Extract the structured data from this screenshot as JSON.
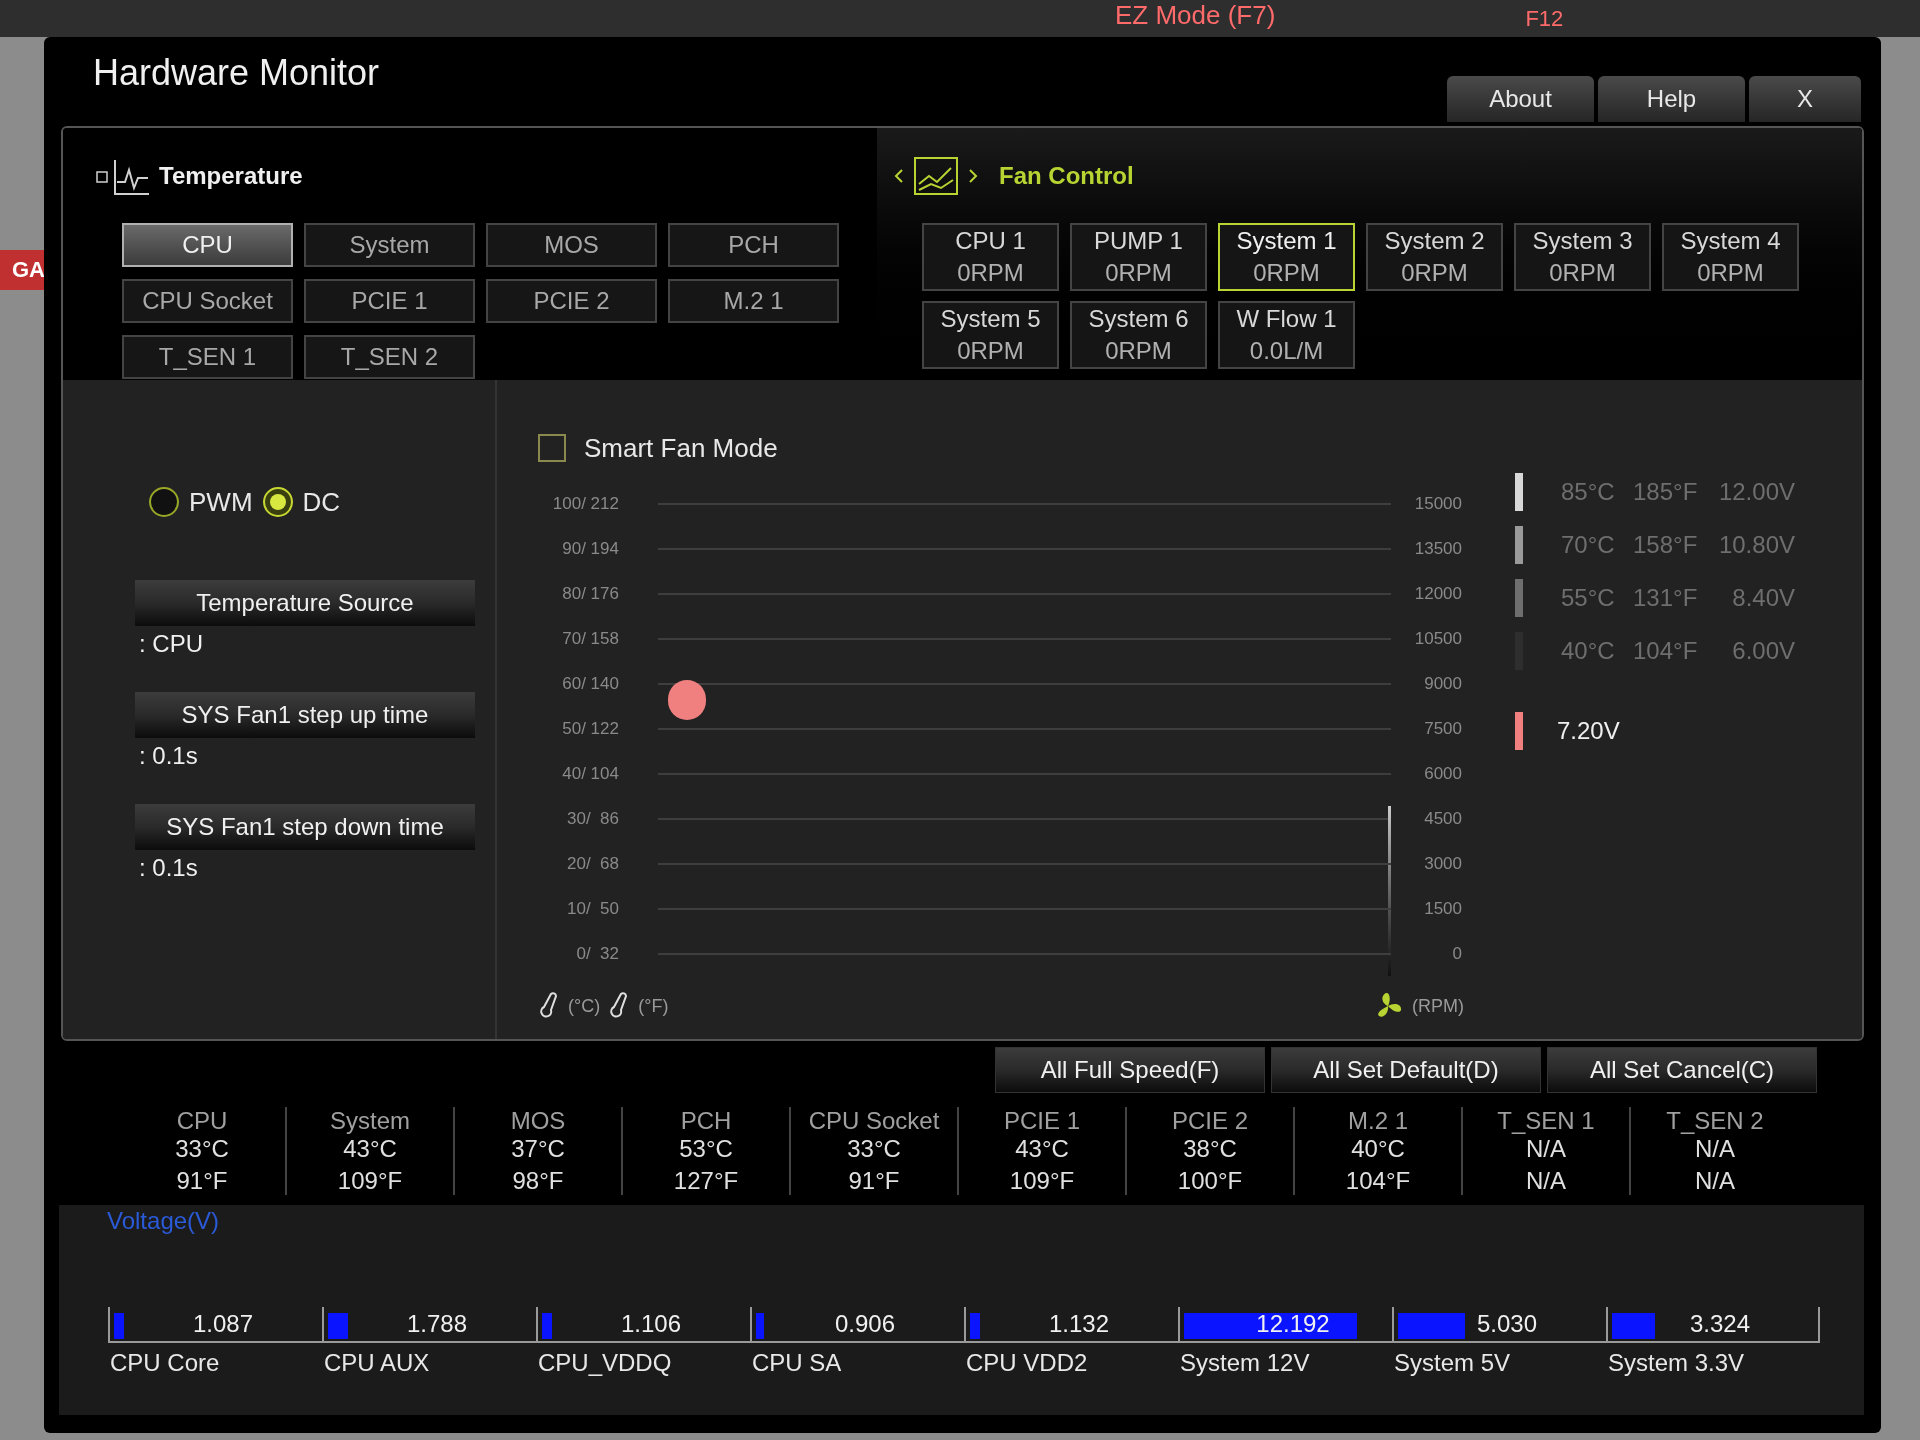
{
  "background": {
    "mode_label": "EZ Mode (F7)",
    "hotkey": "F12",
    "side_tab": "GA"
  },
  "window": {
    "title": "Hardware Monitor",
    "buttons": [
      "About",
      "Help",
      "X"
    ]
  },
  "temperature": {
    "title": "Temperature",
    "sensors": [
      {
        "label": "CPU",
        "selected": true
      },
      {
        "label": "System",
        "selected": false
      },
      {
        "label": "MOS",
        "selected": false
      },
      {
        "label": "PCH",
        "selected": false
      },
      {
        "label": "CPU Socket",
        "selected": false
      },
      {
        "label": "PCIE 1",
        "selected": false
      },
      {
        "label": "PCIE 2",
        "selected": false
      },
      {
        "label": "M.2 1",
        "selected": false
      },
      {
        "label": "T_SEN 1",
        "selected": false
      },
      {
        "label": "T_SEN 2",
        "selected": false
      }
    ]
  },
  "fan_control": {
    "title": "Fan Control",
    "fans": [
      {
        "name": "CPU 1",
        "reading": "0RPM",
        "selected": false
      },
      {
        "name": "PUMP 1",
        "reading": "0RPM",
        "selected": false
      },
      {
        "name": "System 1",
        "reading": "0RPM",
        "selected": true
      },
      {
        "name": "System 2",
        "reading": "0RPM",
        "selected": false
      },
      {
        "name": "System 3",
        "reading": "0RPM",
        "selected": false
      },
      {
        "name": "System 4",
        "reading": "0RPM",
        "selected": false
      },
      {
        "name": "System 5",
        "reading": "0RPM",
        "selected": false
      },
      {
        "name": "System 6",
        "reading": "0RPM",
        "selected": false
      },
      {
        "name": "W Flow 1",
        "reading": "0.0L/M",
        "selected": false
      }
    ]
  },
  "fan_settings": {
    "modes": [
      {
        "label": "PWM",
        "selected": false
      },
      {
        "label": "DC",
        "selected": true
      }
    ],
    "settings": [
      {
        "label": "Temperature Source",
        "value": ": CPU"
      },
      {
        "label": "SYS Fan1 step up time",
        "value": ": 0.1s"
      },
      {
        "label": "SYS Fan1 step down time",
        "value": ": 0.1s"
      }
    ]
  },
  "chart": {
    "smart_fan_mode": {
      "label": "Smart Fan Mode",
      "checked": false
    },
    "left_axis": [
      "100/ 212",
      "90/ 194",
      "80/ 176",
      "70/ 158",
      "60/ 140",
      "50/ 122",
      "40/ 104",
      "30/  86",
      "20/  68",
      "10/  50",
      "0/  32"
    ],
    "right_axis": [
      "15000",
      "13500",
      "12000",
      "10500",
      "9000",
      "7500",
      "6000",
      "4500",
      "3000",
      "1500",
      "0"
    ],
    "celsius_unit": "(°C)",
    "fahrenheit_unit": "(°F)",
    "rpm_unit": "(RPM)",
    "legend": [
      {
        "celsius": "85°C",
        "fahrenheit": "185°F",
        "voltage": "12.00V",
        "color": "#d8d8d8"
      },
      {
        "celsius": "70°C",
        "fahrenheit": "158°F",
        "voltage": "10.80V",
        "color": "#9a9a9a"
      },
      {
        "celsius": "55°C",
        "fahrenheit": "131°F",
        "voltage": "8.40V",
        "color": "#6e6e6e"
      },
      {
        "celsius": "40°C",
        "fahrenheit": "104°F",
        "voltage": "6.00V",
        "color": "#2e2e2e"
      }
    ],
    "current": {
      "voltage": "7.20V",
      "color": "#f08080"
    }
  },
  "actions": [
    "All Full Speed(F)",
    "All Set Default(D)",
    "All Set Cancel(C)"
  ],
  "readings": [
    {
      "name": "CPU",
      "celsius": "33°C",
      "fahrenheit": "91°F"
    },
    {
      "name": "System",
      "celsius": "43°C",
      "fahrenheit": "109°F"
    },
    {
      "name": "MOS",
      "celsius": "37°C",
      "fahrenheit": "98°F"
    },
    {
      "name": "PCH",
      "celsius": "53°C",
      "fahrenheit": "127°F"
    },
    {
      "name": "CPU Socket",
      "celsius": "33°C",
      "fahrenheit": "91°F"
    },
    {
      "name": "PCIE 1",
      "celsius": "43°C",
      "fahrenheit": "109°F"
    },
    {
      "name": "PCIE 2",
      "celsius": "38°C",
      "fahrenheit": "100°F"
    },
    {
      "name": "M.2 1",
      "celsius": "40°C",
      "fahrenheit": "104°F"
    },
    {
      "name": "T_SEN 1",
      "celsius": "N/A",
      "fahrenheit": "N/A"
    },
    {
      "name": "T_SEN 2",
      "celsius": "N/A",
      "fahrenheit": "N/A"
    }
  ],
  "voltage": {
    "title": "Voltage(V)",
    "rails": [
      {
        "name": "CPU Core",
        "value": "1.087",
        "level": 0.05
      },
      {
        "name": "CPU AUX",
        "value": "1.788",
        "level": 0.1
      },
      {
        "name": "CPU_VDDQ",
        "value": "1.106",
        "level": 0.05
      },
      {
        "name": "CPU SA",
        "value": "0.906",
        "level": 0.04
      },
      {
        "name": "CPU VDD2",
        "value": "1.132",
        "level": 0.05
      },
      {
        "name": "System 12V",
        "value": "12.192",
        "level": 0.85
      },
      {
        "name": "System 5V",
        "value": "5.030",
        "level": 0.33
      },
      {
        "name": "System 3.3V",
        "value": "3.324",
        "level": 0.21
      }
    ]
  }
}
